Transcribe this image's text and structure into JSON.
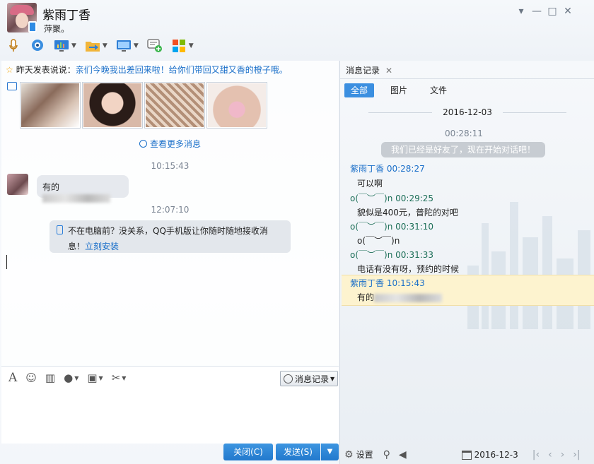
{
  "header": {
    "contact_name": "紫雨丁香",
    "signature": "萍聚。",
    "window_controls": [
      "▾",
      "—",
      "□",
      "✕"
    ]
  },
  "toolbar": {
    "items": [
      "voice-call",
      "video-call",
      "remote-desktop",
      "send-file",
      "screen-share",
      "create-discussion",
      "apps"
    ]
  },
  "chat": {
    "notice_prefix": "昨天发表说说：",
    "notice_text": "亲们今晚我出差回来啦！给你们带回又甜又香的橙子哦。",
    "view_more": "查看更多消息",
    "time1": "10:15:43",
    "msg1": "有的",
    "time2": "12:07:10",
    "system_text": "不在电脑前？没关系，QQ手机版让你随时随地接收消息！",
    "system_link": "立刻安装"
  },
  "input": {
    "history_button": "消息记录",
    "close_button": "关闭(C)",
    "send_button": "发送(S)"
  },
  "history": {
    "tab_title": "消息记录",
    "filters": [
      "全部",
      "图片",
      "文件"
    ],
    "date": "2016-12-03",
    "start_time": "00:28:11",
    "system_msg": "我们已经是好友了，现在开始对话吧！",
    "messages": [
      {
        "sender": "紫雨丁香",
        "time": "00:28:27",
        "text": "可以啊"
      },
      {
        "sender": "o(￣︶￣)n",
        "time": "00:29:25",
        "text": "貌似是400元，普陀的对吧"
      },
      {
        "sender": "o(￣︶￣)n",
        "time": "00:31:10",
        "text": "o(￣︶￣)n"
      },
      {
        "sender": "o(￣︶￣)n",
        "time": "00:31:33",
        "text": "电话有没有呀，预约的时候"
      },
      {
        "sender": "紫雨丁香",
        "time": "10:15:43",
        "text": "有的"
      }
    ],
    "settings_label": "设置",
    "current_date": "2016-12-3"
  },
  "colors": {
    "accent": "#2d84d8",
    "link": "#1a6fc9",
    "highlight": "#fdf3cf"
  }
}
